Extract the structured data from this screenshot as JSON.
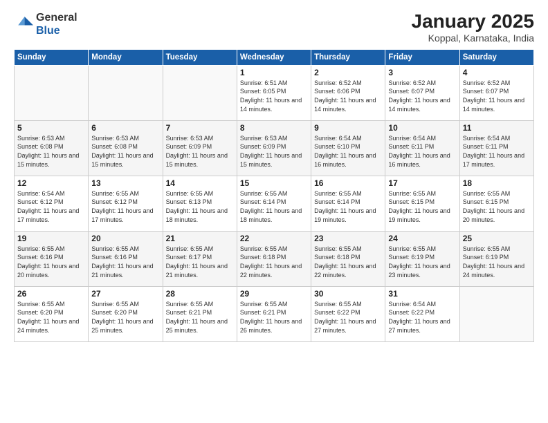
{
  "logo": {
    "line1": "General",
    "line2": "Blue"
  },
  "title": "January 2025",
  "subtitle": "Koppal, Karnataka, India",
  "weekdays": [
    "Sunday",
    "Monday",
    "Tuesday",
    "Wednesday",
    "Thursday",
    "Friday",
    "Saturday"
  ],
  "weeks": [
    [
      {
        "day": "",
        "sunrise": "",
        "sunset": "",
        "daylight": ""
      },
      {
        "day": "",
        "sunrise": "",
        "sunset": "",
        "daylight": ""
      },
      {
        "day": "",
        "sunrise": "",
        "sunset": "",
        "daylight": ""
      },
      {
        "day": "1",
        "sunrise": "Sunrise: 6:51 AM",
        "sunset": "Sunset: 6:05 PM",
        "daylight": "Daylight: 11 hours and 14 minutes."
      },
      {
        "day": "2",
        "sunrise": "Sunrise: 6:52 AM",
        "sunset": "Sunset: 6:06 PM",
        "daylight": "Daylight: 11 hours and 14 minutes."
      },
      {
        "day": "3",
        "sunrise": "Sunrise: 6:52 AM",
        "sunset": "Sunset: 6:07 PM",
        "daylight": "Daylight: 11 hours and 14 minutes."
      },
      {
        "day": "4",
        "sunrise": "Sunrise: 6:52 AM",
        "sunset": "Sunset: 6:07 PM",
        "daylight": "Daylight: 11 hours and 14 minutes."
      }
    ],
    [
      {
        "day": "5",
        "sunrise": "Sunrise: 6:53 AM",
        "sunset": "Sunset: 6:08 PM",
        "daylight": "Daylight: 11 hours and 15 minutes."
      },
      {
        "day": "6",
        "sunrise": "Sunrise: 6:53 AM",
        "sunset": "Sunset: 6:08 PM",
        "daylight": "Daylight: 11 hours and 15 minutes."
      },
      {
        "day": "7",
        "sunrise": "Sunrise: 6:53 AM",
        "sunset": "Sunset: 6:09 PM",
        "daylight": "Daylight: 11 hours and 15 minutes."
      },
      {
        "day": "8",
        "sunrise": "Sunrise: 6:53 AM",
        "sunset": "Sunset: 6:09 PM",
        "daylight": "Daylight: 11 hours and 15 minutes."
      },
      {
        "day": "9",
        "sunrise": "Sunrise: 6:54 AM",
        "sunset": "Sunset: 6:10 PM",
        "daylight": "Daylight: 11 hours and 16 minutes."
      },
      {
        "day": "10",
        "sunrise": "Sunrise: 6:54 AM",
        "sunset": "Sunset: 6:11 PM",
        "daylight": "Daylight: 11 hours and 16 minutes."
      },
      {
        "day": "11",
        "sunrise": "Sunrise: 6:54 AM",
        "sunset": "Sunset: 6:11 PM",
        "daylight": "Daylight: 11 hours and 17 minutes."
      }
    ],
    [
      {
        "day": "12",
        "sunrise": "Sunrise: 6:54 AM",
        "sunset": "Sunset: 6:12 PM",
        "daylight": "Daylight: 11 hours and 17 minutes."
      },
      {
        "day": "13",
        "sunrise": "Sunrise: 6:55 AM",
        "sunset": "Sunset: 6:12 PM",
        "daylight": "Daylight: 11 hours and 17 minutes."
      },
      {
        "day": "14",
        "sunrise": "Sunrise: 6:55 AM",
        "sunset": "Sunset: 6:13 PM",
        "daylight": "Daylight: 11 hours and 18 minutes."
      },
      {
        "day": "15",
        "sunrise": "Sunrise: 6:55 AM",
        "sunset": "Sunset: 6:14 PM",
        "daylight": "Daylight: 11 hours and 18 minutes."
      },
      {
        "day": "16",
        "sunrise": "Sunrise: 6:55 AM",
        "sunset": "Sunset: 6:14 PM",
        "daylight": "Daylight: 11 hours and 19 minutes."
      },
      {
        "day": "17",
        "sunrise": "Sunrise: 6:55 AM",
        "sunset": "Sunset: 6:15 PM",
        "daylight": "Daylight: 11 hours and 19 minutes."
      },
      {
        "day": "18",
        "sunrise": "Sunrise: 6:55 AM",
        "sunset": "Sunset: 6:15 PM",
        "daylight": "Daylight: 11 hours and 20 minutes."
      }
    ],
    [
      {
        "day": "19",
        "sunrise": "Sunrise: 6:55 AM",
        "sunset": "Sunset: 6:16 PM",
        "daylight": "Daylight: 11 hours and 20 minutes."
      },
      {
        "day": "20",
        "sunrise": "Sunrise: 6:55 AM",
        "sunset": "Sunset: 6:16 PM",
        "daylight": "Daylight: 11 hours and 21 minutes."
      },
      {
        "day": "21",
        "sunrise": "Sunrise: 6:55 AM",
        "sunset": "Sunset: 6:17 PM",
        "daylight": "Daylight: 11 hours and 21 minutes."
      },
      {
        "day": "22",
        "sunrise": "Sunrise: 6:55 AM",
        "sunset": "Sunset: 6:18 PM",
        "daylight": "Daylight: 11 hours and 22 minutes."
      },
      {
        "day": "23",
        "sunrise": "Sunrise: 6:55 AM",
        "sunset": "Sunset: 6:18 PM",
        "daylight": "Daylight: 11 hours and 22 minutes."
      },
      {
        "day": "24",
        "sunrise": "Sunrise: 6:55 AM",
        "sunset": "Sunset: 6:19 PM",
        "daylight": "Daylight: 11 hours and 23 minutes."
      },
      {
        "day": "25",
        "sunrise": "Sunrise: 6:55 AM",
        "sunset": "Sunset: 6:19 PM",
        "daylight": "Daylight: 11 hours and 24 minutes."
      }
    ],
    [
      {
        "day": "26",
        "sunrise": "Sunrise: 6:55 AM",
        "sunset": "Sunset: 6:20 PM",
        "daylight": "Daylight: 11 hours and 24 minutes."
      },
      {
        "day": "27",
        "sunrise": "Sunrise: 6:55 AM",
        "sunset": "Sunset: 6:20 PM",
        "daylight": "Daylight: 11 hours and 25 minutes."
      },
      {
        "day": "28",
        "sunrise": "Sunrise: 6:55 AM",
        "sunset": "Sunset: 6:21 PM",
        "daylight": "Daylight: 11 hours and 25 minutes."
      },
      {
        "day": "29",
        "sunrise": "Sunrise: 6:55 AM",
        "sunset": "Sunset: 6:21 PM",
        "daylight": "Daylight: 11 hours and 26 minutes."
      },
      {
        "day": "30",
        "sunrise": "Sunrise: 6:55 AM",
        "sunset": "Sunset: 6:22 PM",
        "daylight": "Daylight: 11 hours and 27 minutes."
      },
      {
        "day": "31",
        "sunrise": "Sunrise: 6:54 AM",
        "sunset": "Sunset: 6:22 PM",
        "daylight": "Daylight: 11 hours and 27 minutes."
      },
      {
        "day": "",
        "sunrise": "",
        "sunset": "",
        "daylight": ""
      }
    ]
  ]
}
